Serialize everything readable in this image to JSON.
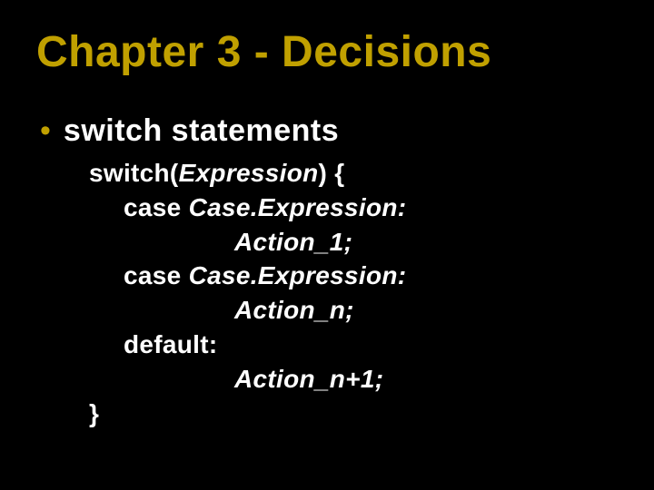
{
  "title": "Chapter 3 - Decisions",
  "bullet": {
    "dot": "•",
    "text": "switch statements"
  },
  "code": {
    "l1_kw": "switch(",
    "l1_expr": "Expression",
    "l1_close": ") {",
    "l2_kw": "case ",
    "l2_expr": "Case.Expression:",
    "l3_expr": "Action_1;",
    "l4_kw": "case ",
    "l4_expr": "Case.Expression:",
    "l5_expr": "Action_n;",
    "l6_kw": "default:",
    "l7_expr": "Action_n+1;",
    "l8_kw": "}"
  }
}
